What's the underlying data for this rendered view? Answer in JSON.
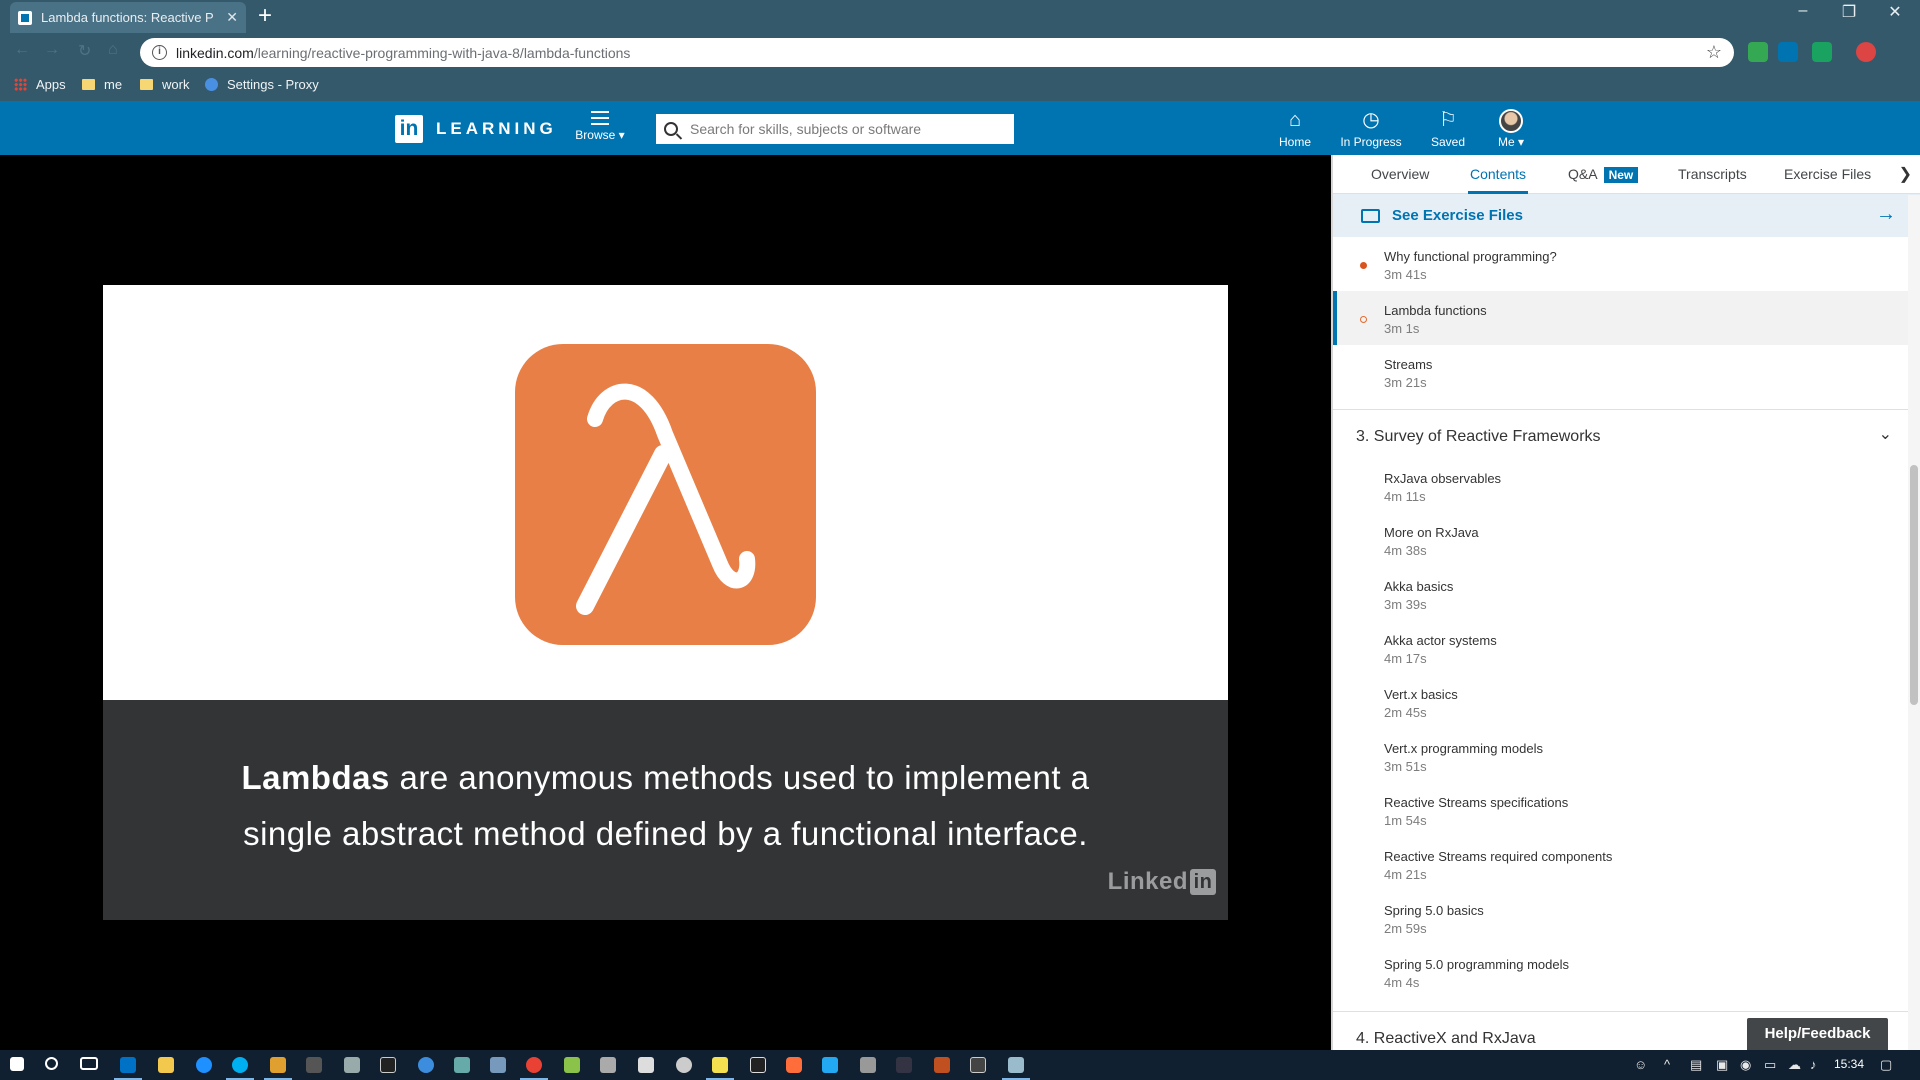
{
  "browser": {
    "tab_title": "Lambda functions: Reactive P",
    "url_host": "linkedin.com",
    "url_path": "/learning/reactive-programming-with-java-8/lambda-functions",
    "bookmarks": [
      "Apps",
      "me",
      "work",
      "Settings - Proxy"
    ]
  },
  "header": {
    "brand": "LEARNING",
    "browse": "Browse",
    "search_placeholder": "Search for skills, subjects or software",
    "nav": [
      "Home",
      "In Progress",
      "Saved",
      "Me"
    ]
  },
  "video": {
    "caption_bold": "Lambdas",
    "caption_rest_line1": " are anonymous methods used to implement a",
    "caption_line2": "single abstract method defined by a functional interface.",
    "watermark": "Linked",
    "watermark_in": "in",
    "colors": {
      "lambda_bg": "#e87f47",
      "caption_bg": "#323436"
    }
  },
  "sidebar": {
    "tabs": [
      "Overview",
      "Contents",
      "Q&A",
      "Transcripts",
      "Exercise Files"
    ],
    "active_tab": "Contents",
    "new_badge": "New",
    "see_exercise": "See Exercise Files",
    "chapter2_items": [
      {
        "name": "Why functional programming?",
        "duration": "3m 41s",
        "status": "viewed"
      },
      {
        "name": "Lambda functions",
        "duration": "3m 1s",
        "status": "in-progress"
      },
      {
        "name": "Streams",
        "duration": "3m 21s",
        "status": "none"
      }
    ],
    "section3_title": "3. Survey of Reactive Frameworks",
    "section3_items": [
      {
        "name": "RxJava observables",
        "duration": "4m 11s"
      },
      {
        "name": "More on RxJava",
        "duration": "4m 38s"
      },
      {
        "name": "Akka basics",
        "duration": "3m 39s"
      },
      {
        "name": "Akka actor systems",
        "duration": "4m 17s"
      },
      {
        "name": "Vert.x basics",
        "duration": "2m 45s"
      },
      {
        "name": "Vert.x programming models",
        "duration": "3m 51s"
      },
      {
        "name": "Reactive Streams specifications",
        "duration": "1m 54s"
      },
      {
        "name": "Reactive Streams required components",
        "duration": "4m 21s"
      },
      {
        "name": "Spring 5.0 basics",
        "duration": "2m 59s"
      },
      {
        "name": "Spring 5.0 programming models",
        "duration": "4m 4s"
      }
    ],
    "section4_title": "4. ReactiveX and RxJava",
    "help": "Help/Feedback"
  },
  "taskbar": {
    "time": "15:34"
  }
}
